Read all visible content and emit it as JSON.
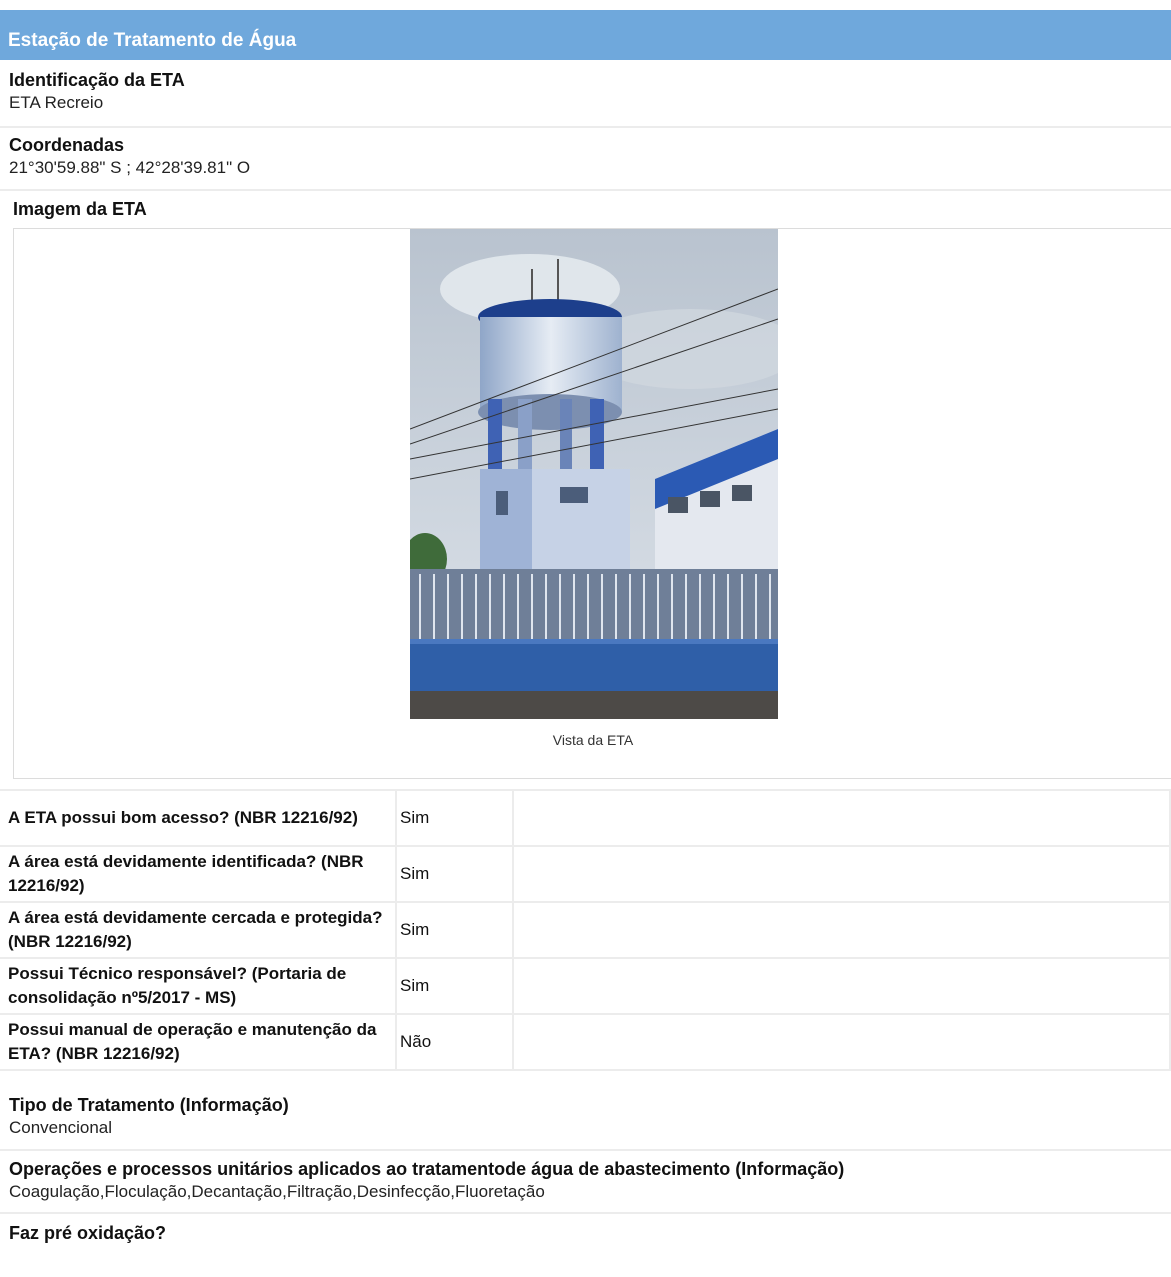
{
  "header": {
    "title": "Estação de Tratamento de Água"
  },
  "identificacao": {
    "label": "Identificação da ETA",
    "value": "ETA Recreio"
  },
  "coordenadas": {
    "label": "Coordenadas",
    "value": "21°30'59.88\" S ; 42°28'39.81\" O"
  },
  "imagem": {
    "label": "Imagem da ETA",
    "caption": "Vista da ETA"
  },
  "questions": [
    {
      "q": "A ETA possui bom acesso? (NBR 12216/92)",
      "a": "Sim"
    },
    {
      "q": "A área está devidamente identificada? (NBR 12216/92)",
      "a": "Sim"
    },
    {
      "q": "A área está devidamente cercada e protegida? (NBR 12216/92)",
      "a": "Sim"
    },
    {
      "q": "Possui Técnico responsável? (Portaria de consolidação nº5/2017 - MS)",
      "a": "Sim"
    },
    {
      "q": "Possui manual de operação e manutenção da ETA? (NBR 12216/92)",
      "a": "Não"
    }
  ],
  "tipo": {
    "label": "Tipo de Tratamento (Informação)",
    "value": "Convencional"
  },
  "operacoes": {
    "label": "Operações e processos unitários aplicados ao tratamentode água de abastecimento (Informação)",
    "value": "Coagulação,Floculação,Decantação,Filtração,Desinfecção,Fluoretação"
  },
  "preoxidacao": {
    "label": "Faz pré oxidação?"
  }
}
